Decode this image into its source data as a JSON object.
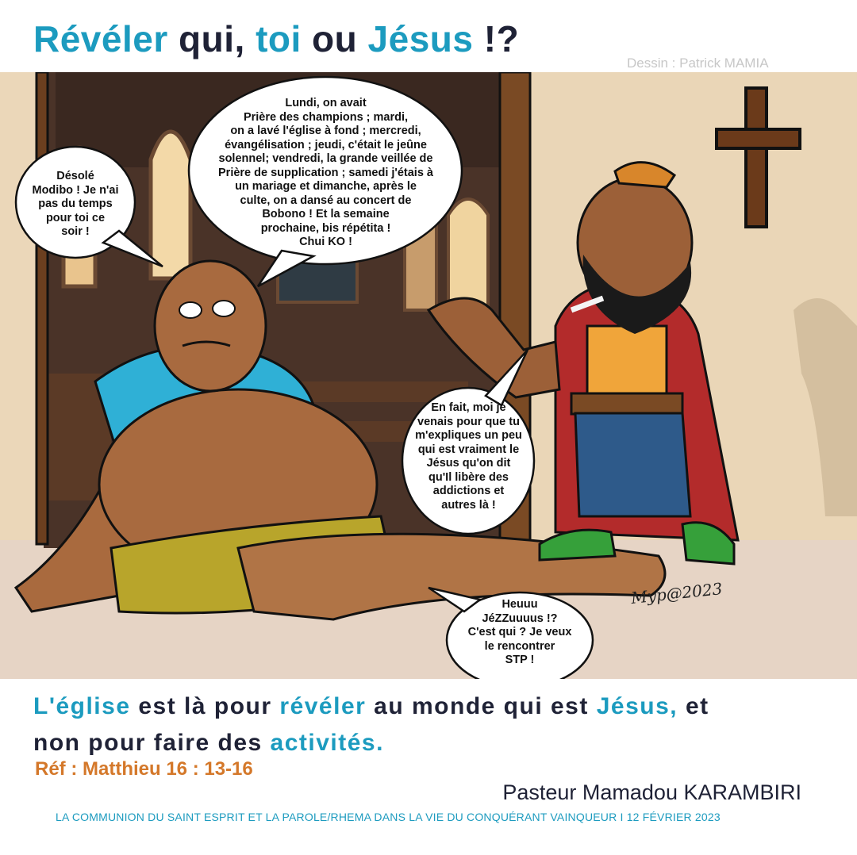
{
  "title": {
    "part1": "Révéler",
    "part2": " qui, ",
    "part3": "toi",
    "part4": " ou ",
    "part5": "Jésus",
    "part6": " !?"
  },
  "credit": "Dessin : Patrick MAMIA",
  "bubbles": {
    "modibo_sorry": "Désolé\nModibo ! Je n'ai\npas du temps\npour toi ce\nsoir !",
    "week_activities": "Lundi, on avait\nPrière des champions ; mardi,\non a lavé l'église à fond ; mercredi,\névangélisation ; jeudi, c'était le jeûne\nsolennel; vendredi, la grande veillée de\nPrière de supplication ; samedi j'étais à\nun mariage et dimanche, après le\nculte, on a dansé au concert de\nBobono ! Et la semaine\nprochaine, bis répétita !\nChui KO !",
    "visitor_question": "En fait, moi je\nvenais pour que tu\nm'expliques un peu\nqui est vraiment le\nJésus qu'on dit\nqu'Il libère des\naddictions et\nautres là !",
    "who_is_jesus": "Heuuu\nJéZZuuuus !?\nC'est qui ? Je veux\nle rencontrer\nSTP !"
  },
  "signature": "Myp@2023",
  "message": {
    "w1": "L'église",
    "w2": " est là pour ",
    "w3": "révéler",
    "w4": " au monde qui est ",
    "w5": "Jésus,",
    "w6": " et",
    "w7": "non pour faire des ",
    "w8": "activités."
  },
  "reference": "Réf : Matthieu 16 : 13-16",
  "pastor": "Pasteur Mamadou KARAMBIRI",
  "footer": "LA COMMUNION DU SAINT ESPRIT ET LA PAROLE/RHEMA DANS LA VIE DU CONQUÉRANT VAINQUEUR  I 12 FÉVRIER 2023",
  "colors": {
    "accent_teal": "#1c9bbf",
    "text_dark": "#1f2236",
    "reference_orange": "#d4782a",
    "credit_gray": "#c7c7c7"
  },
  "icons": [
    "cross-icon"
  ]
}
